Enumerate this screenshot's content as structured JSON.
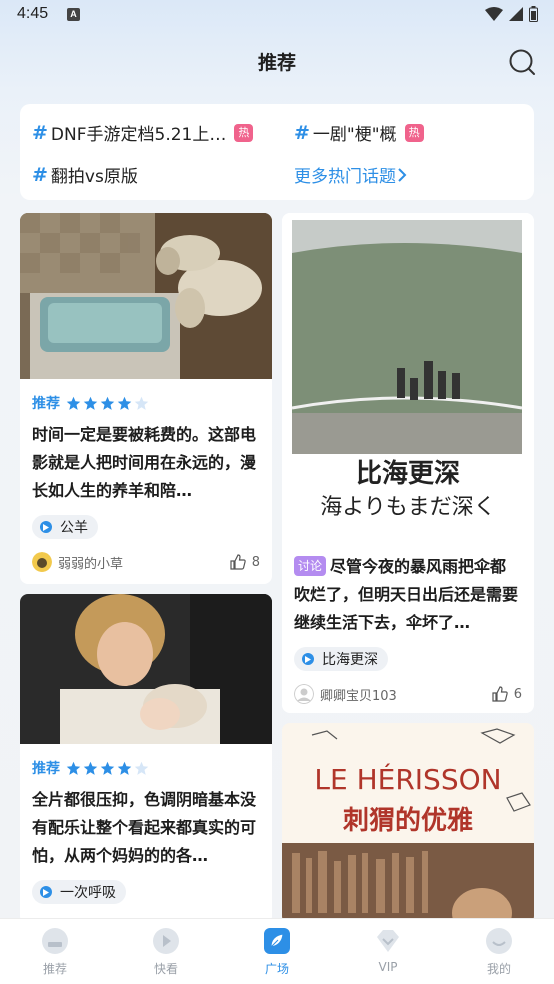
{
  "status_bar": {
    "time": "4:45",
    "badge": "A"
  },
  "header": {
    "title": "推荐"
  },
  "topics": {
    "items": [
      {
        "label": "DNF手游定档5.21上…",
        "hot": "热"
      },
      {
        "label": "一剧\"梗\"概",
        "hot": "热"
      },
      {
        "label": "翻拍vs原版",
        "hot": ""
      }
    ],
    "hash": "#",
    "more": "更多热门话题"
  },
  "cards": [
    {
      "tag": "推荐",
      "stars": 4,
      "text": "时间一定是要被耗费的。这部电影就是人把时间用在永远的，漫长如人生的养羊和陪…",
      "chip": "公羊",
      "author": "弱弱的小草",
      "likes": "8"
    },
    {
      "discuss": "讨论",
      "poster_title_cn": "比海更深",
      "poster_title_jp": "海よりもまだ深く",
      "text": "尽管今夜的暴风雨把伞都吹烂了，但明天日出后还是需要继续生活下去，伞坏了…",
      "chip": "比海更深",
      "author": "卿卿宝贝103",
      "likes": "6"
    },
    {
      "tag": "推荐",
      "stars": 4,
      "text": "全片都很压抑，色调阴暗基本没有配乐让整个看起来都真实的可怕，从两个妈妈的的各…",
      "chip": "一次呼吸"
    },
    {
      "poster_title_fr": "LE HÉRISSON",
      "poster_title_cn": "刺猬的优雅"
    }
  ],
  "bottom_nav": [
    {
      "label": "推荐",
      "active": false
    },
    {
      "label": "快看",
      "active": false
    },
    {
      "label": "广场",
      "active": true
    },
    {
      "label": "VIP",
      "active": false
    },
    {
      "label": "我的",
      "active": false
    }
  ],
  "colors": {
    "accent": "#2d8fe6",
    "hot": "#f0638c",
    "discuss": "#b48cf0"
  }
}
